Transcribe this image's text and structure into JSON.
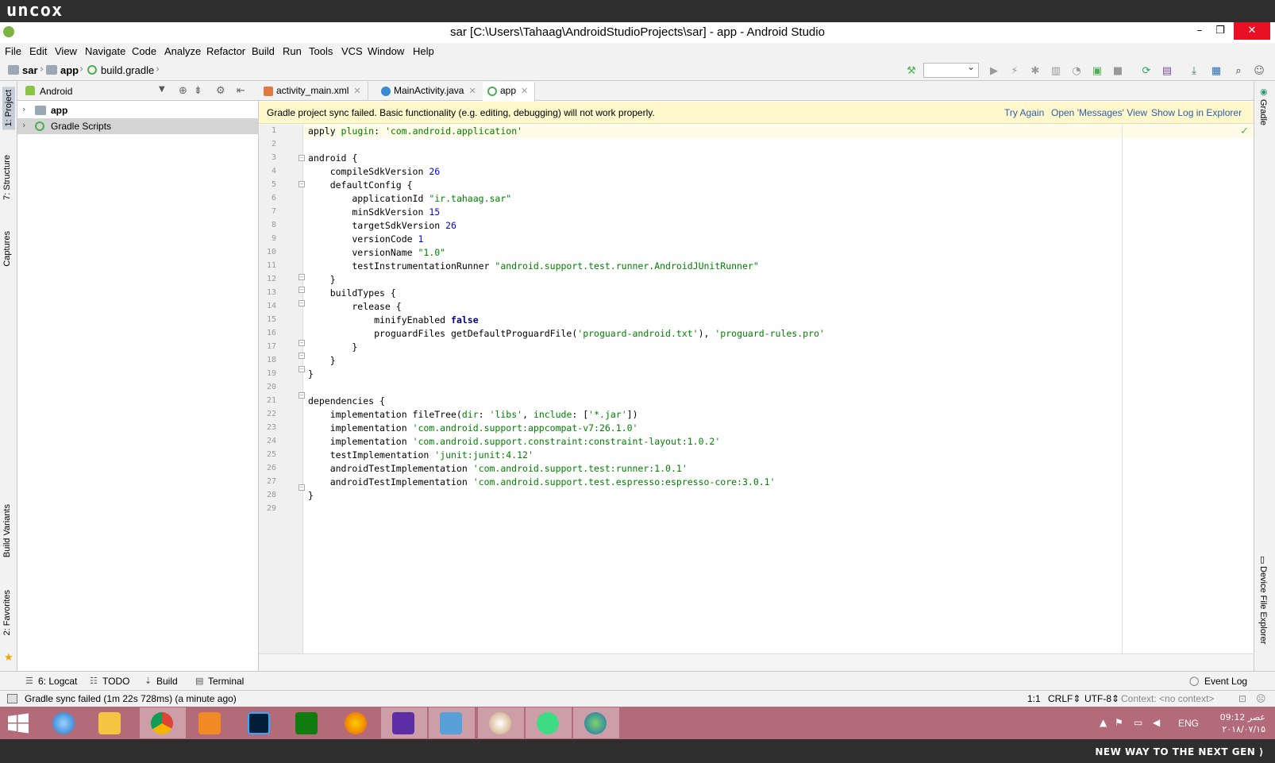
{
  "branding": {
    "logo": "uncox",
    "tagline": "NEW WAY TO THE NEXT GEN ⟩"
  },
  "window": {
    "title": "sar [C:\\Users\\Tahaag\\AndroidStudioProjects\\sar] - app - Android Studio",
    "minimize": "–",
    "maximize": "❐",
    "close": "✕"
  },
  "menu": [
    "File",
    "Edit",
    "View",
    "Navigate",
    "Code",
    "Analyze",
    "Refactor",
    "Build",
    "Run",
    "Tools",
    "VCS",
    "Window",
    "Help"
  ],
  "breadcrumbs": [
    "sar",
    "app",
    "build.gradle"
  ],
  "left_tools": {
    "project": "1: Project",
    "structure": "7: Structure",
    "captures": "Captures",
    "build_variants": "Build Variants",
    "favorites": "2: Favorites"
  },
  "project_pane": {
    "view_mode": "Android",
    "items": [
      {
        "label": "app",
        "icon": "folder-icon"
      },
      {
        "label": "Gradle Scripts",
        "icon": "gradle-icon"
      }
    ]
  },
  "tabs": [
    {
      "label": "activity_main.xml",
      "icon": "xml-file-icon"
    },
    {
      "label": "MainActivity.java",
      "icon": "java-class-icon"
    },
    {
      "label": "app",
      "icon": "gradle-icon"
    }
  ],
  "sync_banner": {
    "message": "Gradle project sync failed. Basic functionality (e.g. editing, debugging) will not work properly.",
    "try_again": "Try Again",
    "open_messages": "Open 'Messages' View",
    "show_log": "Show Log in Explorer"
  },
  "code": {
    "line_numbers": [
      "1",
      "2",
      "3",
      "4",
      "5",
      "6",
      "7",
      "8",
      "9",
      "10",
      "11",
      "12",
      "13",
      "14",
      "15",
      "16",
      "17",
      "18",
      "19",
      "20",
      "21",
      "22",
      "23",
      "24",
      "25",
      "26",
      "27",
      "28",
      "29"
    ],
    "lines": [
      "apply plugin: 'com.android.application'",
      "",
      "android {",
      "    compileSdkVersion 26",
      "    defaultConfig {",
      "        applicationId \"ir.tahaag.sar\"",
      "        minSdkVersion 15",
      "        targetSdkVersion 26",
      "        versionCode 1",
      "        versionName \"1.0\"",
      "        testInstrumentationRunner \"android.support.test.runner.AndroidJUnitRunner\"",
      "    }",
      "    buildTypes {",
      "        release {",
      "            minifyEnabled false",
      "            proguardFiles getDefaultProguardFile('proguard-android.txt'), 'proguard-rules.pro'",
      "        }",
      "    }",
      "}",
      "",
      "dependencies {",
      "    implementation fileTree(dir: 'libs', include: ['*.jar'])",
      "    implementation 'com.android.support:appcompat-v7:26.1.0'",
      "    implementation 'com.android.support.constraint:constraint-layout:1.0.2'",
      "    testImplementation 'junit:junit:4.12'",
      "    androidTestImplementation 'com.android.support.test:runner:1.0.1'",
      "    androidTestImplementation 'com.android.support.test.espresso:espresso-core:3.0.1'",
      "}",
      ""
    ]
  },
  "right_tools": {
    "gradle": "Gradle",
    "device_file_explorer": "Device File Explorer"
  },
  "bottom_tools": {
    "logcat": "6: Logcat",
    "todo": "TODO",
    "build": "Build",
    "terminal": "Terminal",
    "event_log": "Event Log"
  },
  "status": {
    "message": "Gradle sync failed (1m 22s 728ms) (a minute ago)",
    "position": "1:1",
    "line_separator": "CRLF⇕",
    "encoding": "UTF-8⇕",
    "context": "Context: <no context>"
  },
  "taskbar": {
    "apps": [
      "Internet Explorer",
      "File Explorer",
      "Chrome",
      "Media Player",
      "Photoshop",
      "Store",
      "Firefox",
      "Settings",
      "Control Panel",
      "Paint",
      "Android Studio",
      "Network Globe"
    ],
    "language": "ENG",
    "time": "09:12 عصر",
    "date": "۲۰۱۸/۰۷/۱۵"
  },
  "colors": {
    "taskbar": "#b36a79",
    "banner": "#fff8cc",
    "string": "#008000",
    "keyword": "#000080",
    "number": "#0000ff"
  }
}
